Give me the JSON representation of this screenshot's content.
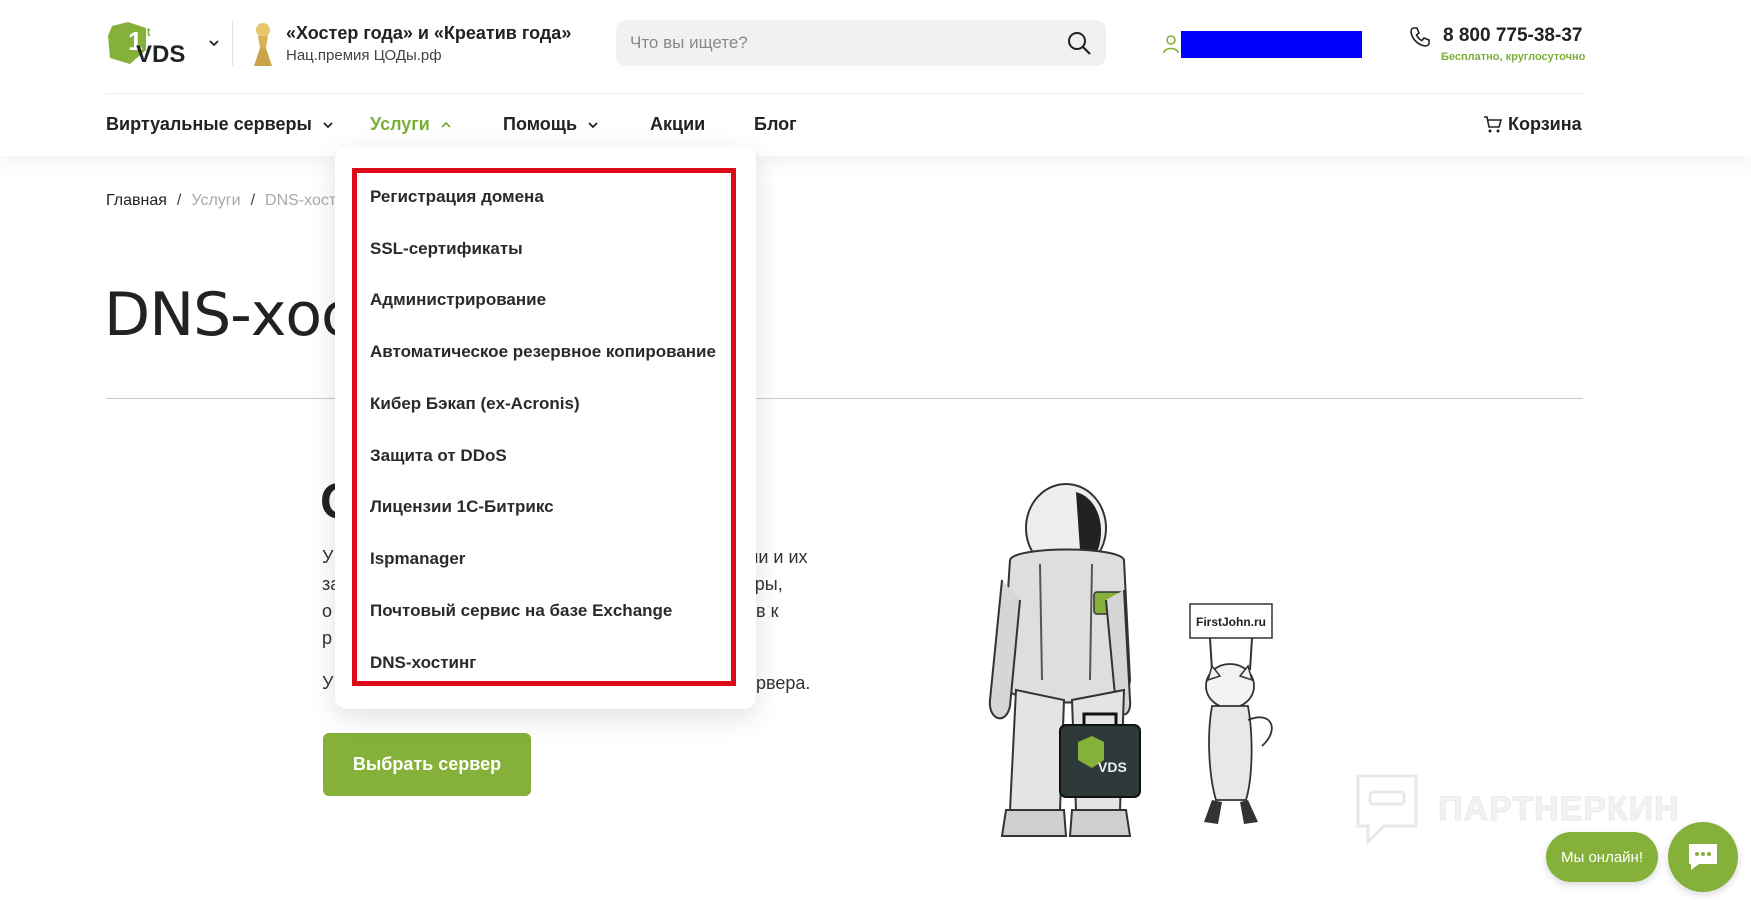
{
  "header": {
    "logo_alt": "1stVDS",
    "award": {
      "title": "«Хостер года» и «Креатив года»",
      "subtitle": "Нац.премия ЦОДы.рф"
    },
    "search": {
      "placeholder": "Что вы ищете?"
    },
    "phone": {
      "number": "8 800 775-38-37",
      "note": "Бесплатно, круглосуточно"
    }
  },
  "nav": {
    "items": [
      {
        "label": "Виртуальные серверы",
        "has_dropdown": true
      },
      {
        "label": "Услуги",
        "has_dropdown": true,
        "active": true
      },
      {
        "label": "Помощь",
        "has_dropdown": true
      },
      {
        "label": "Акции"
      },
      {
        "label": "Блог"
      }
    ],
    "cart_label": "Корзина"
  },
  "dropdown": {
    "items": [
      "Регистрация домена",
      "SSL-сертификаты",
      "Администрирование",
      "Автоматическое резервное копирование",
      "Кибер Бэкап (ex-Acronis)",
      "Защита от DDoS",
      "Лицензии 1С-Битрикс",
      "Ispmanager",
      "Почтовый сервис на базе Exchange",
      "DNS-хостинг"
    ]
  },
  "breadcrumb": {
    "home": "Главная",
    "section": "Услуги",
    "current": "DNS-хостинг"
  },
  "page": {
    "title": "DNS-хостинг",
    "section_heading": "О",
    "paragraph_fragments": [
      {
        "left": "У",
        "right": "ми и их"
      },
      {
        "left": "за",
        "right": "уры,"
      },
      {
        "left": "о",
        "right": "ов к"
      },
      {
        "left": "р",
        "right": ""
      },
      {
        "left": "У",
        "right": "ервера."
      }
    ],
    "cta_label": "Выбрать сервер",
    "sign_text": "FirstJohn.ru"
  },
  "watermark": "ПАРТНЕРКИН",
  "chat": {
    "online_label": "Мы онлайн!"
  },
  "colors": {
    "accent": "#85b13a",
    "highlight": "#dd0a17",
    "user_mask": "#0000ff"
  }
}
